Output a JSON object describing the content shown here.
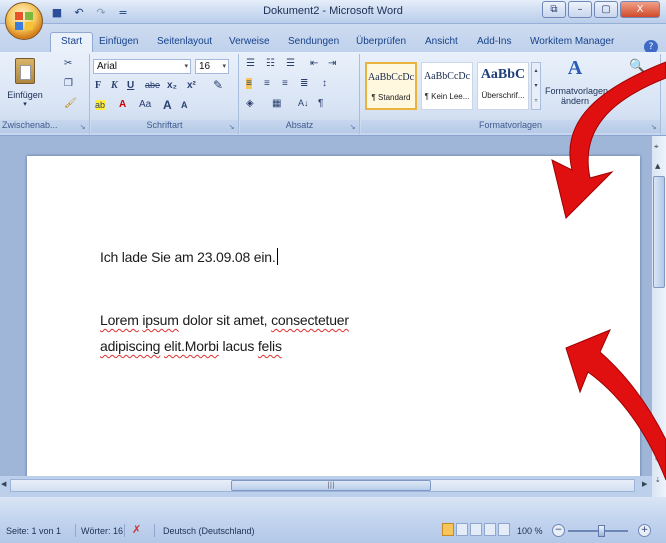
{
  "window": {
    "title": "Dokument2 - Microsoft Word",
    "minimize": "–",
    "maximize": "▢",
    "close": "X",
    "restore_small": "▭",
    "doc_restore": "⧉"
  },
  "qat": {
    "save": "💾",
    "undo": "↶",
    "redo": "↷",
    "more": "="
  },
  "tabs": [
    "Start",
    "Einfügen",
    "Seitenlayout",
    "Verweise",
    "Sendungen",
    "Überprüfen",
    "Ansicht",
    "Add-Ins",
    "Workitem Manager"
  ],
  "help": "?",
  "clipboard": {
    "paste_label": "Einfügen",
    "group_label": "Zwischenab..."
  },
  "font": {
    "name": "Arial",
    "size": "16",
    "group_label": "Schriftart",
    "bold": "F",
    "italic": "K",
    "underline": "U",
    "strike": "abe",
    "sub": "x₂",
    "sup": "x²",
    "grow": "A",
    "shrink": "A",
    "case": "Aa",
    "color": "A",
    "highlight": "ab"
  },
  "paragraph": {
    "group_label": "Absatz",
    "pilcrow": "¶",
    "sort": "A↓"
  },
  "styles": {
    "group_label": "Formatvorlagen",
    "items": [
      {
        "sample": "AaBbCcDc",
        "name": "¶ Standard"
      },
      {
        "sample": "AaBbCcDc",
        "name": "¶ Kein Lee..."
      },
      {
        "sample": "AaBbC",
        "name": "Überschrif..."
      }
    ],
    "change_label": "Formatvorlagen ändern",
    "change_label_1": "Formatvorlagen",
    "change_label_2": "ändern"
  },
  "doc": {
    "line1": "Ich lade Sie am 23.09.08 ein.",
    "p2a_1": "Lorem",
    "p2a_2": "ipsum",
    "p2a_3": "dolor sit amet,",
    "p2a_4": "consectetuer",
    "p2b_1": "adipiscing",
    "p2b_2": "elit.Morbi",
    "p2b_3": "lacus",
    "p2b_4": "felis"
  },
  "status": {
    "page": "Seite: 1 von 1",
    "words": "Wörter: 16",
    "language": "Deutsch (Deutschland)",
    "zoom": "100 %",
    "zoom_minus": "−",
    "zoom_plus": "+"
  },
  "colors": {
    "arrow": "#e01010",
    "ribbon": "#d7e3f4",
    "background": "#1a2460"
  },
  "icons": [
    "office-button-icon",
    "save-icon",
    "undo-icon",
    "redo-icon",
    "paste-icon",
    "cut-icon",
    "copy-icon",
    "format-painter-icon",
    "bullets-icon",
    "numbering-icon",
    "align-left-icon",
    "change-styles-icon",
    "find-icon",
    "spellcheck-icon",
    "red-arrow-icon"
  ]
}
